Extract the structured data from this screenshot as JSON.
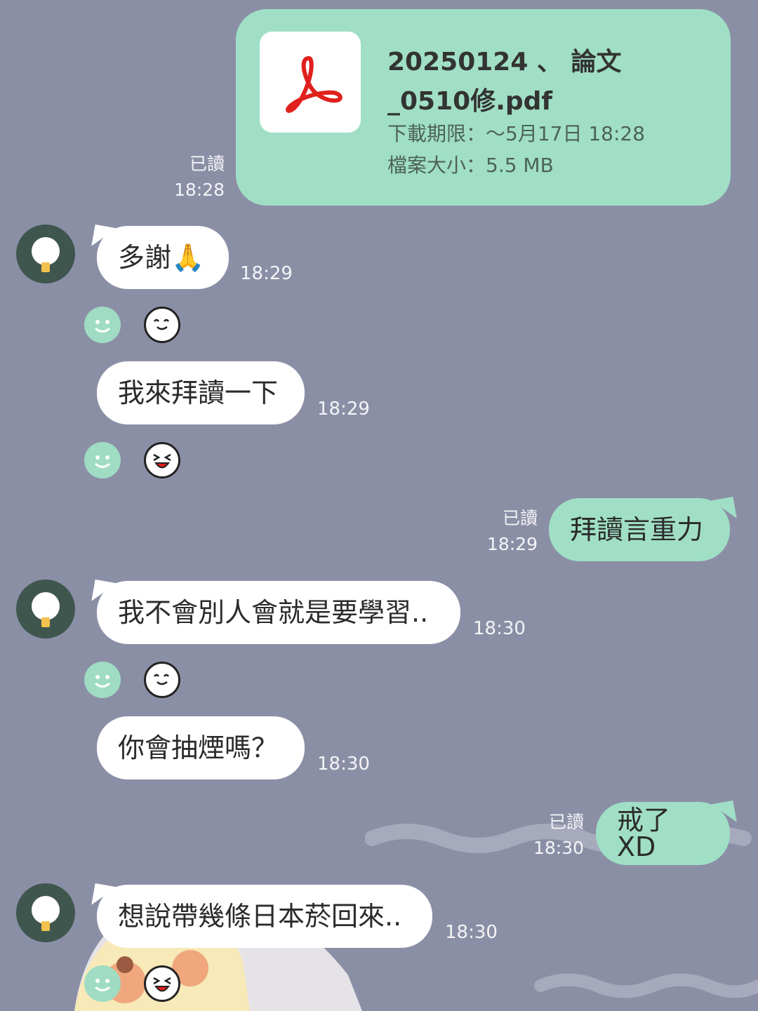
{
  "file_message": {
    "name_line1": "20250124 、            論文",
    "name_line2": "_0510修.pdf",
    "expiry": "下載期限：～5月17日 18:28",
    "size": "檔案大小：5.5 MB",
    "read_label": "已讀",
    "time": "18:28"
  },
  "messages": [
    {
      "text": "多謝🙏",
      "time": "18:29"
    },
    {
      "text": "我來拜讀一下",
      "time": "18:29"
    },
    {
      "text": "拜讀言重力",
      "time": "18:29",
      "read_label": "已讀"
    },
    {
      "text": "我不會別人會就是要學習..",
      "time": "18:30"
    },
    {
      "text": "你會抽煙嗎？",
      "time": "18:30"
    },
    {
      "text": "戒了XD",
      "time": "18:30",
      "read_label": "已讀"
    },
    {
      "text": "想說帶幾條日本菸回來..",
      "time": "18:30"
    }
  ],
  "colors": {
    "background": "#8b8fa6",
    "outgoing_bubble": "#a0dfc6",
    "incoming_bubble": "#ffffff",
    "pdf_icon": "#e0201c"
  },
  "icons": [
    "pdf-icon",
    "avatar-icon",
    "smile-reaction-icon",
    "thumbs-up-sticker-icon",
    "laughing-sticker-icon"
  ]
}
